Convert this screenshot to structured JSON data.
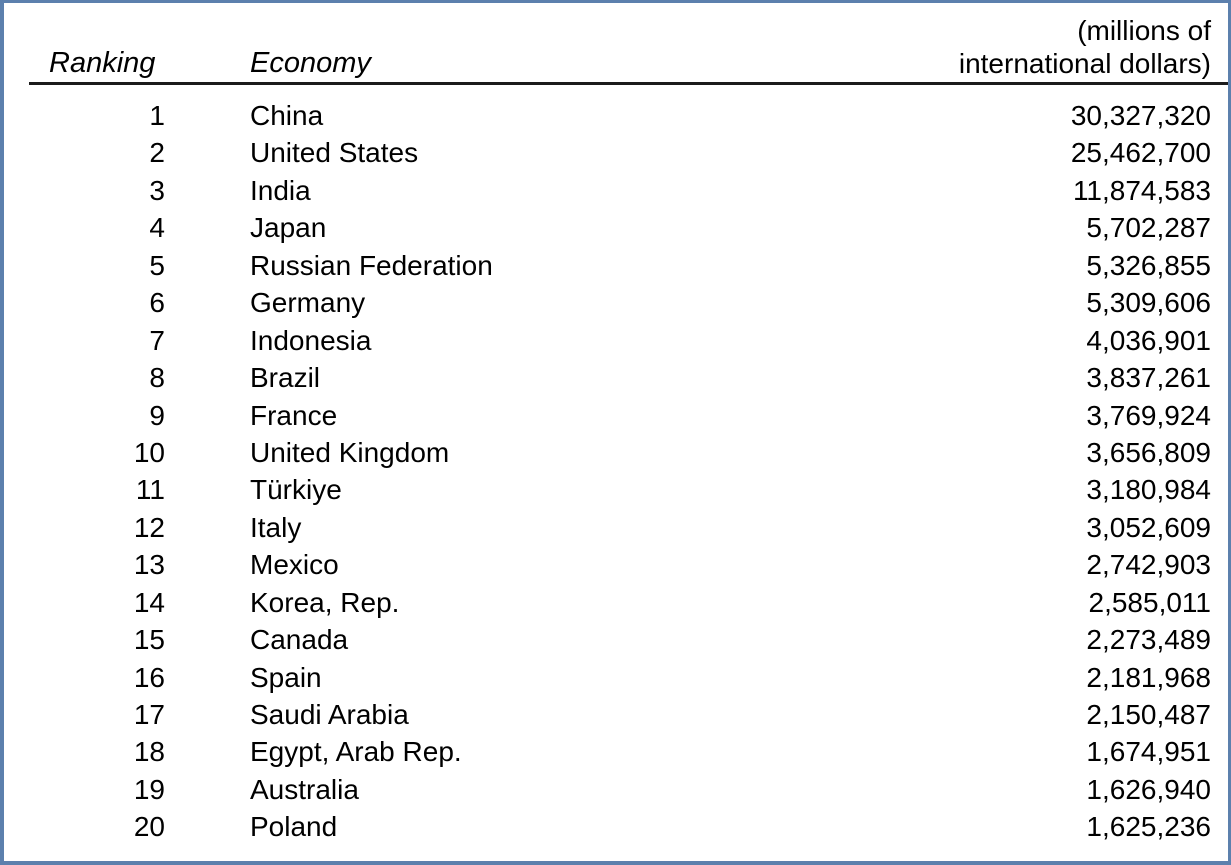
{
  "table": {
    "columns": {
      "ranking": "Ranking",
      "economy": "Economy",
      "units_line1": "(millions of",
      "units_line2": "international dollars)"
    },
    "rows": [
      {
        "rank": "1",
        "economy": "China",
        "value": "30,327,320"
      },
      {
        "rank": "2",
        "economy": "United States",
        "value": "25,462,700"
      },
      {
        "rank": "3",
        "economy": "India",
        "value": "11,874,583"
      },
      {
        "rank": "4",
        "economy": "Japan",
        "value": "5,702,287"
      },
      {
        "rank": "5",
        "economy": "Russian Federation",
        "value": "5,326,855"
      },
      {
        "rank": "6",
        "economy": "Germany",
        "value": "5,309,606"
      },
      {
        "rank": "7",
        "economy": "Indonesia",
        "value": "4,036,901"
      },
      {
        "rank": "8",
        "economy": "Brazil",
        "value": "3,837,261"
      },
      {
        "rank": "9",
        "economy": "France",
        "value": "3,769,924"
      },
      {
        "rank": "10",
        "economy": "United Kingdom",
        "value": "3,656,809"
      },
      {
        "rank": "11",
        "economy": "Türkiye",
        "value": "3,180,984"
      },
      {
        "rank": "12",
        "economy": "Italy",
        "value": "3,052,609"
      },
      {
        "rank": "13",
        "economy": "Mexico",
        "value": "2,742,903"
      },
      {
        "rank": "14",
        "economy": "Korea, Rep.",
        "value": "2,585,011"
      },
      {
        "rank": "15",
        "economy": "Canada",
        "value": "2,273,489"
      },
      {
        "rank": "16",
        "economy": "Spain",
        "value": "2,181,968"
      },
      {
        "rank": "17",
        "economy": "Saudi Arabia",
        "value": "2,150,487"
      },
      {
        "rank": "18",
        "economy": "Egypt, Arab Rep.",
        "value": "1,674,951"
      },
      {
        "rank": "19",
        "economy": "Australia",
        "value": "1,626,940"
      },
      {
        "rank": "20",
        "economy": "Poland",
        "value": "1,625,236"
      }
    ]
  },
  "chart_data": {
    "type": "table",
    "title": "",
    "columns": [
      "Ranking",
      "Economy",
      "(millions of international dollars)"
    ],
    "categories": [
      "China",
      "United States",
      "India",
      "Japan",
      "Russian Federation",
      "Germany",
      "Indonesia",
      "Brazil",
      "France",
      "United Kingdom",
      "Türkiye",
      "Italy",
      "Mexico",
      "Korea, Rep.",
      "Canada",
      "Spain",
      "Saudi Arabia",
      "Egypt, Arab Rep.",
      "Australia",
      "Poland"
    ],
    "values": [
      30327320,
      25462700,
      11874583,
      5702287,
      5326855,
      5309606,
      4036901,
      3837261,
      3769924,
      3656809,
      3180984,
      3052609,
      2742903,
      2585011,
      2273489,
      2181968,
      2150487,
      1674951,
      1626940,
      1625236
    ],
    "ranks": [
      1,
      2,
      3,
      4,
      5,
      6,
      7,
      8,
      9,
      10,
      11,
      12,
      13,
      14,
      15,
      16,
      17,
      18,
      19,
      20
    ],
    "xlabel": "Economy",
    "ylabel": "millions of international dollars",
    "units": "millions of international dollars"
  },
  "style": {
    "frame_color": "#5c80ad",
    "rule_color": "#1b1b1b",
    "text_color": "#000000",
    "background": "#ffffff"
  }
}
